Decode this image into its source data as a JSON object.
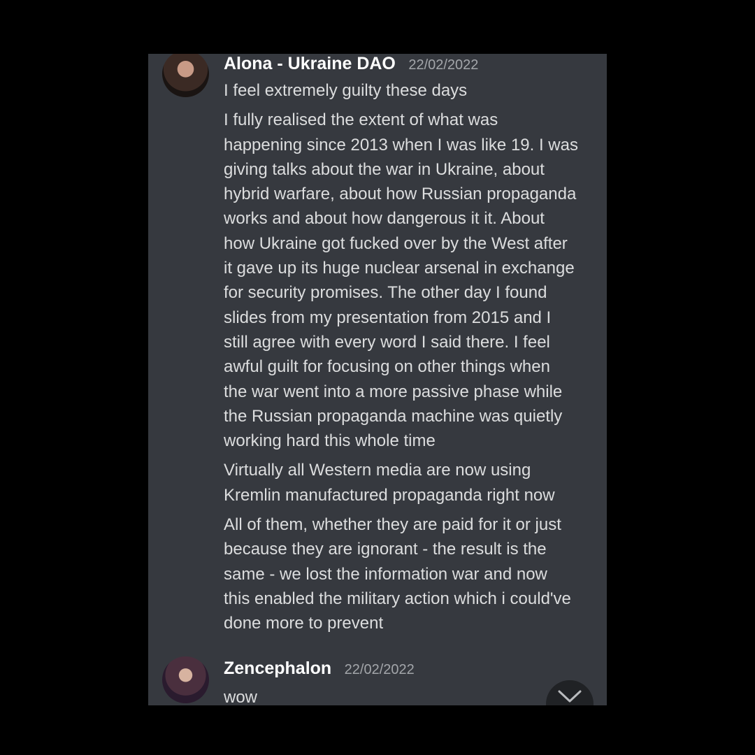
{
  "messages": [
    {
      "username": "Alona - Ukraine DAO",
      "timestamp": "22/02/2022",
      "paragraphs": [
        [
          "I feel extremely guilty these days"
        ],
        [
          "I fully realised the extent of what was",
          "happening since 2013 when I was like 19. I was",
          "giving talks about the war in Ukraine, about",
          "hybrid warfare, about how Russian propaganda",
          "works and about how dangerous it it. About",
          "how Ukraine got fucked over by the West after",
          "it gave up its huge nuclear arsenal in exchange",
          "for security promises. The other day I found",
          "slides from my presentation from 2015 and I",
          "still agree with every word I said there. I feel",
          "awful guilt for focusing on other things when",
          "the war went into a more passive phase while",
          "the Russian propaganda machine was quietly",
          "working hard this whole time"
        ],
        [
          "Virtually all Western media are now using",
          "Kremlin manufactured propaganda right now"
        ],
        [
          "All of them, whether they are paid for it or just",
          "because they are ignorant - the result is the",
          "same - we lost the information war and now",
          "this enabled the military action which i could've",
          "done more to prevent"
        ]
      ]
    },
    {
      "username": "Zencephalon",
      "timestamp": "22/02/2022",
      "paragraphs": [
        [
          "wow"
        ]
      ]
    }
  ],
  "colors": {
    "background": "#000000",
    "panel": "#36393f",
    "username": "#ffffff",
    "timestamp": "#a3a6aa",
    "text": "#dcddde",
    "scroll_button": "#202225"
  },
  "icons": {
    "scroll_button": "chevron-down-icon"
  }
}
